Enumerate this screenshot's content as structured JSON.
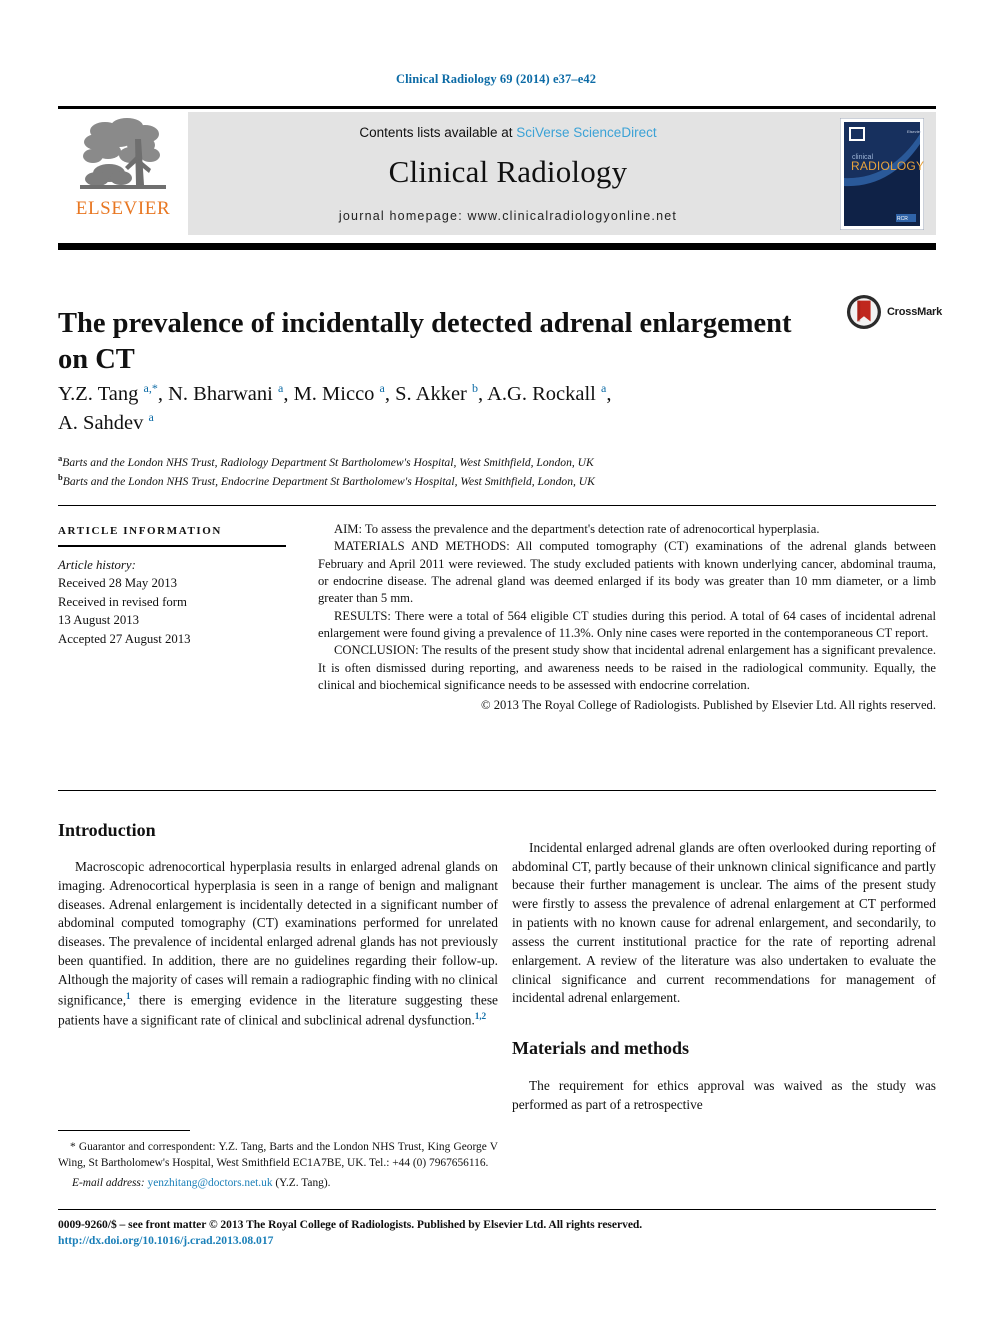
{
  "running_head": "Clinical Radiology 69 (2014) e37–e42",
  "masthead": {
    "publisher_logo_name": "elsevier-tree-logo",
    "publisher_wordmark": "ELSEVIER",
    "contents_prefix": "Contents lists available at",
    "contents_link": "SciVerse ScienceDirect",
    "journal_name": "Clinical Radiology",
    "homepage_label": "journal homepage: www.clinicalradiologyonline.net",
    "cover": {
      "line1": "clinical",
      "line2": "RADIOLOGY",
      "corner_label": "Elsevier"
    }
  },
  "article": {
    "title": "The prevalence of incidentally detected adrenal enlargement on CT",
    "crossmark_label": "CrossMark",
    "authors_html": "Y.Z. Tang <sup>a,*</sup>, N. Bharwani <sup>a</sup>, M. Micco <sup>a</sup>, S. Akker <sup>b</sup>, A.G. Rockall <sup>a</sup>, A. Sahdev <sup>a</sup>",
    "authors_plain": "Y.Z. Tang a,*, N. Bharwani a, M. Micco a, S. Akker b, A.G. Rockall a, A. Sahdev a",
    "affiliations": [
      {
        "marker": "a",
        "text": "Barts and the London NHS Trust, Radiology Department St Bartholomew's Hospital, West Smithfield, London, UK"
      },
      {
        "marker": "b",
        "text": "Barts and the London NHS Trust, Endocrine Department St Bartholomew's Hospital, West Smithfield, London, UK"
      }
    ]
  },
  "article_info": {
    "heading": "ARTICLE INFORMATION",
    "history_label": "Article history:",
    "history_lines": [
      "Received 28 May 2013",
      "Received in revised form",
      "13 August 2013",
      "Accepted 27 August 2013"
    ]
  },
  "abstract": {
    "aim": "AIM: To assess the prevalence and the department's detection rate of adrenocortical hyperplasia.",
    "materials": "MATERIALS AND METHODS: All computed tomography (CT) examinations of the adrenal glands between February and April 2011 were reviewed. The study excluded patients with known underlying cancer, abdominal trauma, or endocrine disease. The adrenal gland was deemed enlarged if its body was greater than 10 mm diameter, or a limb greater than 5 mm.",
    "results": "RESULTS: There were a total of 564 eligible CT studies during this period. A total of 64 cases of incidental adrenal enlargement were found giving a prevalence of 11.3%. Only nine cases were reported in the contemporaneous CT report.",
    "conclusion": "CONCLUSION: The results of the present study show that incidental adrenal enlargement has a significant prevalence. It is often dismissed during reporting, and awareness needs to be raised in the radiological community. Equally, the clinical and biochemical significance needs to be assessed with endocrine correlation.",
    "copyright": "© 2013 The Royal College of Radiologists. Published by Elsevier Ltd. All rights reserved."
  },
  "body": {
    "introduction_heading": "Introduction",
    "intro_para_1_a": "Macroscopic adrenocortical hyperplasia results in enlarged adrenal glands on imaging. Adrenocortical hyperplasia is seen in a range of benign and malignant diseases. Adrenal enlargement is incidentally detected in a significant number of abdominal computed tomography (CT) examinations performed for unrelated diseases. The prevalence of incidental enlarged adrenal glands has not previously been quantified. In addition, there are no guidelines regarding their follow-up. Although the majority of cases will remain a radiographic finding with no clinical significance,",
    "intro_ref_1": "1",
    "intro_para_1_b": " there is emerging evidence in the literature suggesting these patients have a significant rate of clinical and subclinical adrenal dysfunction.",
    "intro_ref_2": "1,2",
    "intro_para_2": "Incidental enlarged adrenal glands are often overlooked during reporting of abdominal CT, partly because of their unknown clinical significance and partly because their further management is unclear. The aims of the present study were firstly to assess the prevalence of adrenal enlargement at CT performed in patients with no known cause for adrenal enlargement, and secondarily, to assess the current institutional practice for the rate of reporting adrenal enlargement. A review of the literature was also undertaken to evaluate the clinical significance and current recommendations for management of incidental adrenal enlargement.",
    "materials_heading": "Materials and methods",
    "materials_para": "The requirement for ethics approval was waived as the study was performed as part of a retrospective"
  },
  "footnote": {
    "corresponding": "* Guarantor and correspondent: Y.Z. Tang, Barts and the London NHS Trust, King George V Wing, St Bartholomew's Hospital, West Smithfield EC1A7BE, UK. Tel.: +44 (0) 7967656116.",
    "email_label": "E-mail address:",
    "email": "yenzhitang@doctors.net.uk",
    "email_suffix": "(Y.Z. Tang)."
  },
  "footer": {
    "issn_line": "0009-9260/$ – see front matter © 2013 The Royal College of Radiologists. Published by Elsevier Ltd. All rights reserved.",
    "doi": "http://dx.doi.org/10.1016/j.crad.2013.08.017"
  },
  "colors": {
    "link_blue": "#1a7fb8",
    "accent_blue": "#0c6ba6",
    "sciencedirect_blue": "#3ba2d6",
    "elsevier_orange": "#e87722",
    "masthead_grey": "#e3e3e3",
    "cover_navy": "#17305e",
    "crossmark_red": "#c0281e"
  }
}
